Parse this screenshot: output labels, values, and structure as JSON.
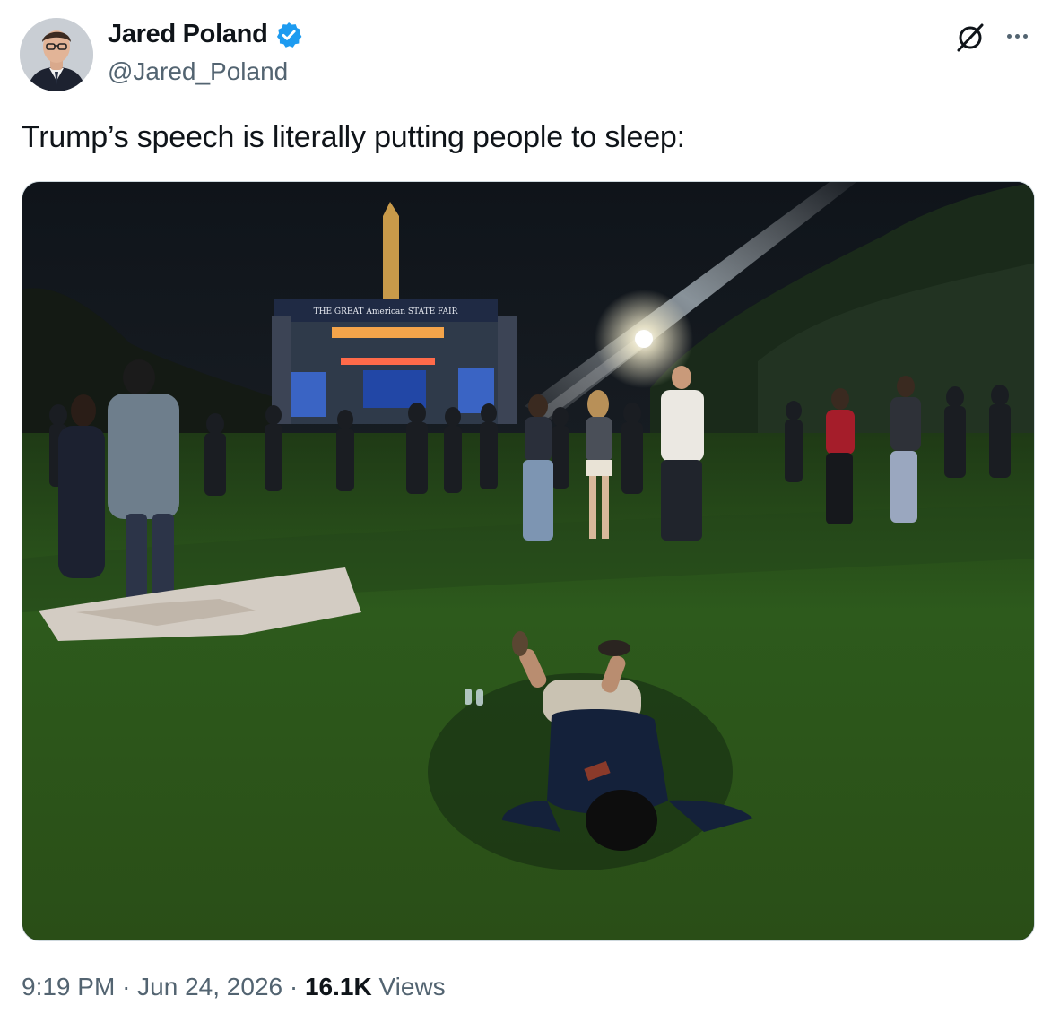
{
  "author": {
    "display_name": "Jared Poland",
    "handle": "@Jared_Poland",
    "verified": true,
    "avatar_icon": "profile-photo",
    "verified_icon": "verified-badge-icon"
  },
  "actions": {
    "grok_icon": "grok-icon",
    "more_icon": "more-options-icon"
  },
  "tweet": {
    "text": "Trump’s speech is literally putting people to sleep:"
  },
  "media": {
    "alt_description": "Crowd on lawn at night with a stage and monument in the background; a person lying asleep on the grass in the foreground",
    "stage_banner": "THE GREAT American STATE FAIR"
  },
  "meta": {
    "time": "9:19 PM",
    "separator": "·",
    "date": "Jun 24, 2026",
    "views_count": "16.1K",
    "views_label": "Views"
  },
  "colors": {
    "verified": "#1d9bf0",
    "secondary_text": "#536471",
    "primary_text": "#0f1419",
    "media_border": "#cfd9de"
  }
}
